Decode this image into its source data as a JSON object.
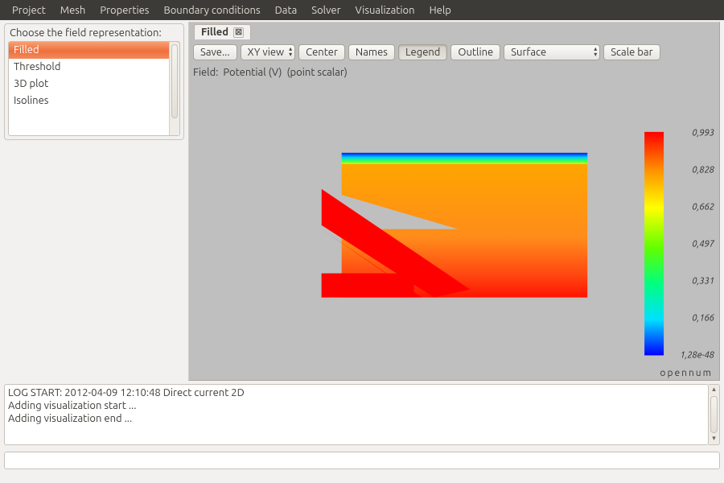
{
  "menubar": [
    "Project",
    "Mesh",
    "Properties",
    "Boundary conditions",
    "Data",
    "Solver",
    "Visualization",
    "Help"
  ],
  "side_panel": {
    "title": "Choose the field representation:",
    "items": [
      "Filled",
      "Threshold",
      "3D plot",
      "Isolines"
    ],
    "selected_index": 0
  },
  "tab": {
    "label": "Filled"
  },
  "toolbar": {
    "save": "Save...",
    "xyview": "XY view",
    "center": "Center",
    "names": "Names",
    "legend": "Legend",
    "outline": "Outline",
    "surface_select": "Surface",
    "scalebar": "Scale bar"
  },
  "field_info": {
    "prefix": "Field:",
    "name": "Potential (V)",
    "type": "(point scalar)"
  },
  "colorbar": {
    "labels": [
      "0,993",
      "0,828",
      "0,662",
      "0,497",
      "0,331",
      "0,166",
      "1,28e-48"
    ]
  },
  "branding": "opennum",
  "log": {
    "lines": [
      "LOG START: 2012-04-09 12:10:48 Direct current 2D",
      "Adding visualization start ...",
      "Adding visualization end ..."
    ]
  },
  "command_input": {
    "value": ""
  }
}
